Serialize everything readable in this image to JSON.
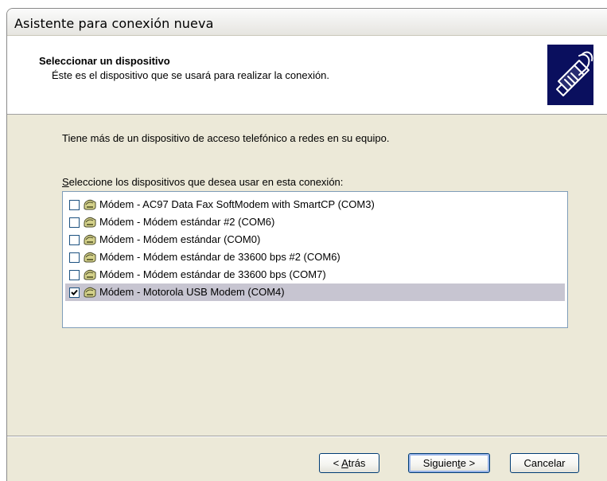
{
  "window": {
    "title": "Asistente para conexión nueva"
  },
  "header": {
    "title": "Seleccionar un dispositivo",
    "subtitle": "Éste es el dispositivo que se usará para realizar la conexión.",
    "icon": "network-cable-icon"
  },
  "content": {
    "info_text": "Tiene más de un dispositivo de acceso telefónico a redes en su equipo.",
    "list_label_accel": "S",
    "list_label_rest": "eleccione los dispositivos que desea usar en esta conexión:"
  },
  "devices": [
    {
      "label": "Módem - AC97 Data Fax SoftModem with SmartCP (COM3)",
      "checked": false,
      "icon": "modem-icon"
    },
    {
      "label": "Módem - Módem estándar #2 (COM6)",
      "checked": false,
      "icon": "modem-icon"
    },
    {
      "label": "Módem - Módem estándar (COM0)",
      "checked": false,
      "icon": "modem-icon"
    },
    {
      "label": "Módem - Módem estándar de 33600 bps #2 (COM6)",
      "checked": false,
      "icon": "modem-icon"
    },
    {
      "label": "Módem - Módem estándar de 33600 bps (COM7)",
      "checked": false,
      "icon": "modem-icon"
    },
    {
      "label": "Módem - Motorola USB Modem (COM4)",
      "checked": true,
      "selected": true,
      "icon": "modem-icon"
    }
  ],
  "buttons": {
    "back_pre": "< ",
    "back_accel": "A",
    "back_post": "trás",
    "next_pre": "Siguien",
    "next_accel": "t",
    "next_post": "e >",
    "cancel": "Cancelar"
  }
}
